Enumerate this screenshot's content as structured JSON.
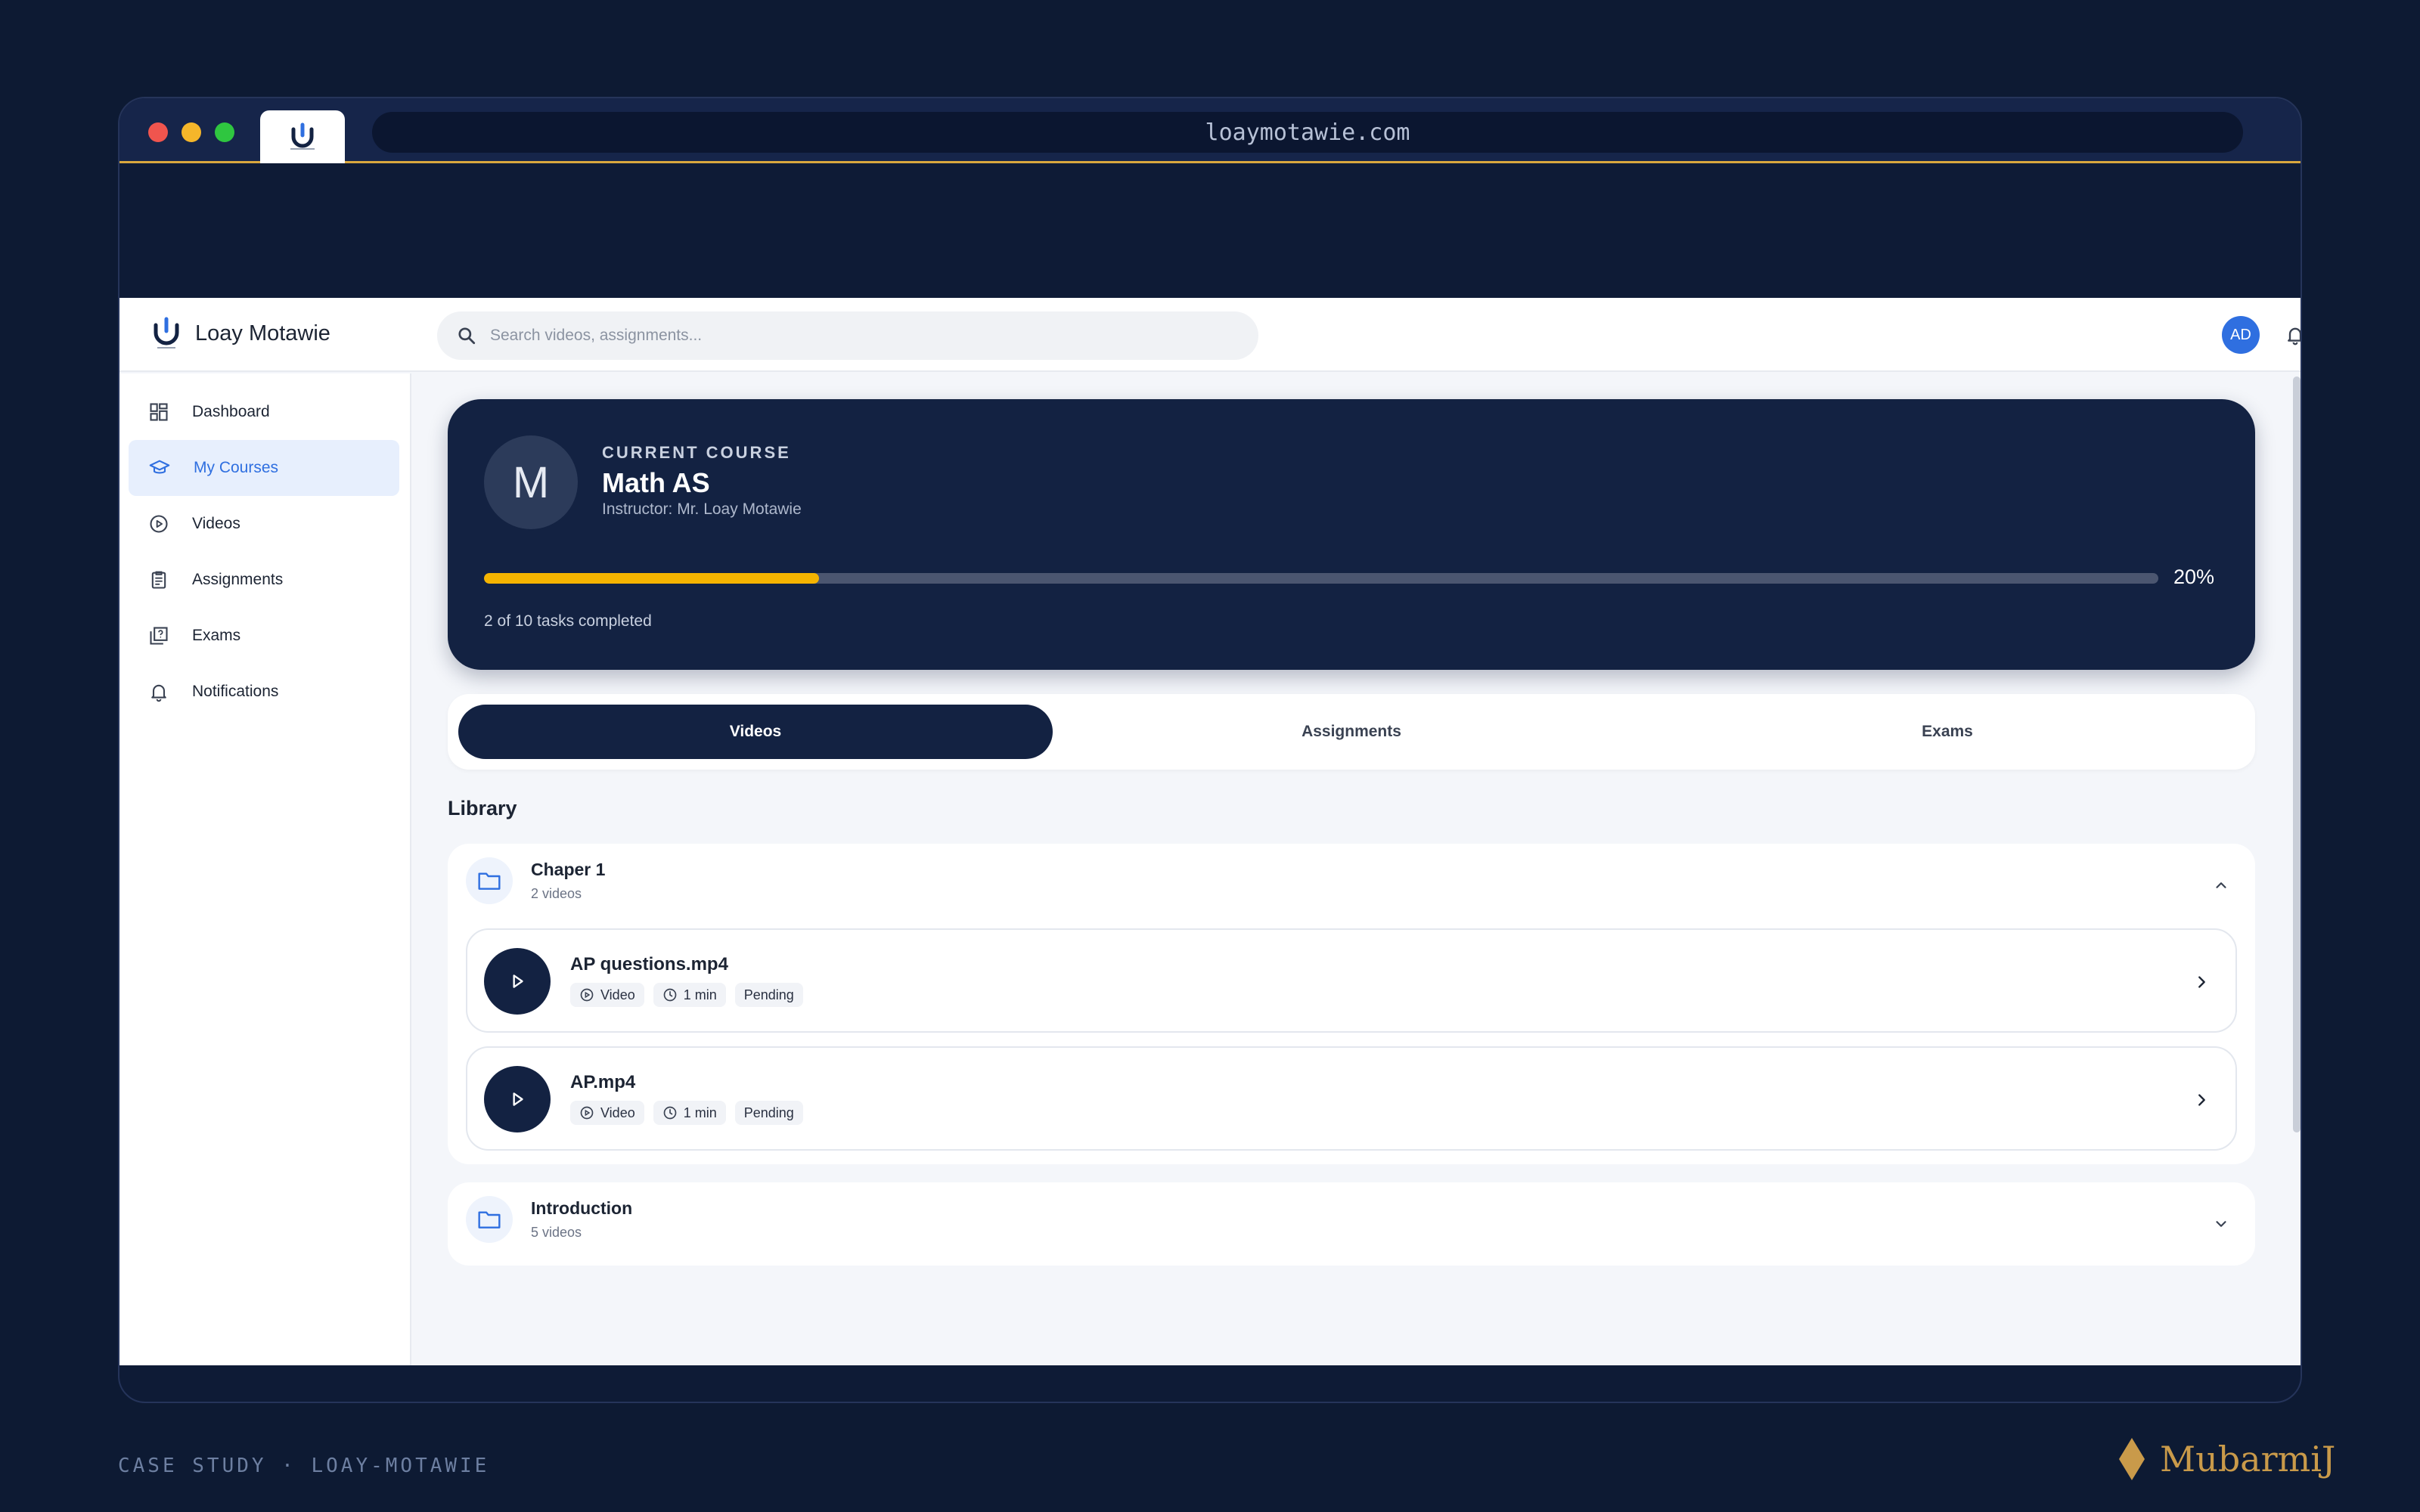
{
  "browser": {
    "url": "loaymotawie.com"
  },
  "app": {
    "brand_name": "Loay Motawie",
    "search_placeholder": "Search videos, assignments...",
    "avatar_initials": "AD"
  },
  "sidebar": {
    "items": [
      {
        "label": "Dashboard",
        "icon": "dashboard-icon",
        "active": false
      },
      {
        "label": "My Courses",
        "icon": "graduation-cap-icon",
        "active": true
      },
      {
        "label": "Videos",
        "icon": "play-circle-icon",
        "active": false
      },
      {
        "label": "Assignments",
        "icon": "clipboard-icon",
        "active": false
      },
      {
        "label": "Exams",
        "icon": "exam-icon",
        "active": false
      },
      {
        "label": "Notifications",
        "icon": "bell-icon",
        "active": false
      }
    ]
  },
  "course": {
    "avatar_letter": "M",
    "eyebrow": "CURRENT COURSE",
    "title": "Math AS",
    "instructor": "Instructor: Mr. Loay Motawie",
    "progress_percent": 20,
    "progress_label": "20%",
    "tasks_text": "2 of 10 tasks completed"
  },
  "tabs": [
    {
      "label": "Videos",
      "active": true
    },
    {
      "label": "Assignments",
      "active": false
    },
    {
      "label": "Exams",
      "active": false
    }
  ],
  "library": {
    "title": "Library",
    "chapters": [
      {
        "name": "Chaper 1",
        "count": "2 videos",
        "expanded": true,
        "videos": [
          {
            "title": "AP questions.mp4",
            "type": "Video",
            "duration": "1 min",
            "status": "Pending"
          },
          {
            "title": "AP.mp4",
            "type": "Video",
            "duration": "1 min",
            "status": "Pending"
          }
        ]
      },
      {
        "name": "Introduction",
        "count": "5 videos",
        "expanded": false
      }
    ]
  },
  "footer": {
    "left_text": "CASE STUDY · LOAY-MOTAWIE",
    "brand": "MubarmiJ"
  },
  "colors": {
    "navy": "#132242",
    "accent_blue": "#2f6fe0",
    "progress_yellow": "#f5b400",
    "gold": "#c99a4a"
  }
}
